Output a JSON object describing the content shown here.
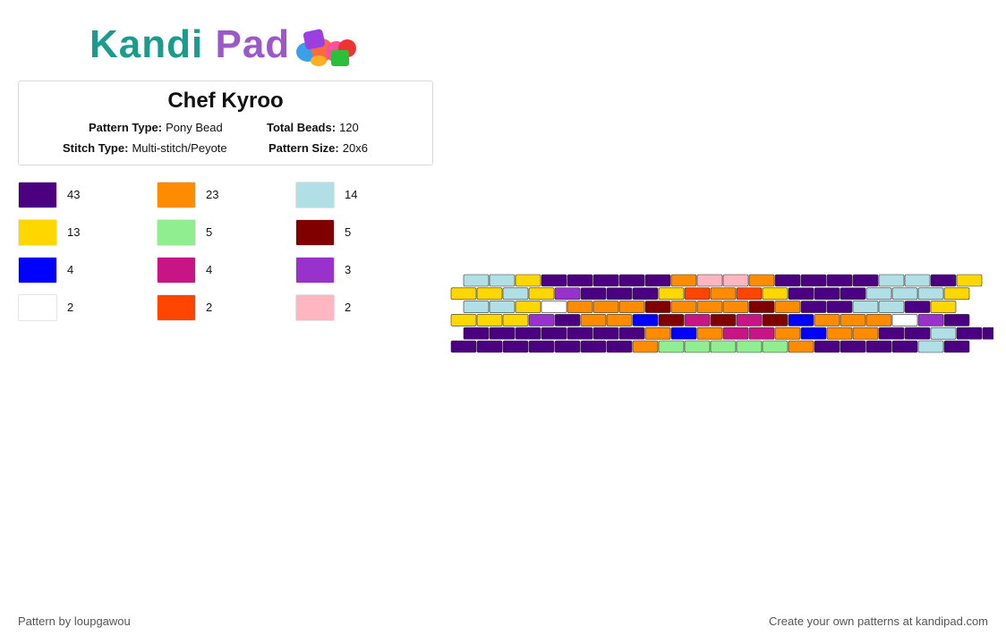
{
  "logo": {
    "part1": "Kandi",
    "part2": "Pad"
  },
  "header": {
    "title": "Chef Kyroo",
    "pattern_type_label": "Pattern Type:",
    "pattern_type_value": "Pony Bead",
    "total_beads_label": "Total Beads:",
    "total_beads_value": "120",
    "stitch_type_label": "Stitch Type:",
    "stitch_type_value": "Multi-stitch/Peyote",
    "pattern_size_label": "Pattern Size:",
    "pattern_size_value": "20x6"
  },
  "legend": [
    {
      "color": "#4b0082",
      "count": "43"
    },
    {
      "color": "#ff8c00",
      "count": "23"
    },
    {
      "color": "#b0e0e6",
      "count": "14"
    },
    {
      "color": "#ffd700",
      "count": "13"
    },
    {
      "color": "#90ee90",
      "count": "5"
    },
    {
      "color": "#800000",
      "count": "5"
    },
    {
      "color": "#0000ff",
      "count": "4"
    },
    {
      "color": "#c71585",
      "count": "4"
    },
    {
      "color": "#9932cc",
      "count": "3"
    },
    {
      "color": "#ffffff",
      "count": "2"
    },
    {
      "color": "#ff4500",
      "count": "2"
    },
    {
      "color": "#ffb6c1",
      "count": "2"
    }
  ],
  "bead_key": {
    "P": "#4b0082",
    "O": "#ff8c00",
    "L": "#b0e0e6",
    "Y": "#ffd700",
    "G": "#90ee90",
    "M": "#800000",
    "B": "#0000ff",
    "C": "#c71585",
    "V": "#9932cc",
    "W": "#ffffff",
    "R": "#ff4500",
    "K": "#ffb6c1"
  },
  "pattern_rows": [
    "LLYPPPPPOKKOPPPPLLPY",
    "YYLYVPPPYRORYPPPLLLY",
    "LLYWOOOMOOOMOPPLLPY",
    "YYYVPOOBMCMCMBOOOWVP",
    "PPPPPPPOBOCCOBOOPPLPP",
    "PPPPPPPOGGGGGOPPPPLP"
  ],
  "footer": {
    "left": "Pattern by loupgawou",
    "right": "Create your own patterns at kandipad.com"
  }
}
